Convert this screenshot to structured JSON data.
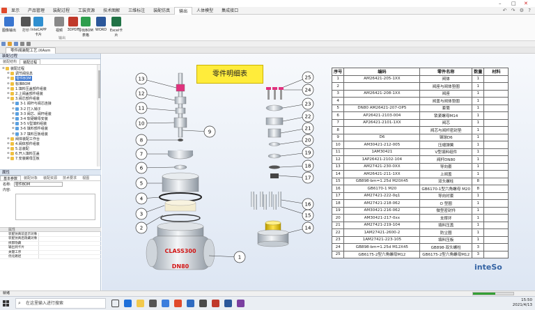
{
  "menubar": {
    "items": [
      "显示",
      "产品管理",
      "装配过程",
      "工装资源",
      "技术图解",
      "三维标注",
      "装配仿真",
      "输出",
      "人体模型",
      "集成接口"
    ],
    "active_index": 7
  },
  "ribbon": {
    "buttons": [
      "图像输出",
      "打印",
      "InteCAPP卡片",
      "视频",
      "3DPDF",
      "导出BOM表格",
      "WORD",
      "Excel卡片"
    ],
    "group_label": "输出"
  },
  "document_tab": "零件阀装配工艺.iXAsm",
  "left_panel": {
    "title": "装配过程",
    "tabs": [
      "装配结构",
      "装配过程"
    ],
    "active_tab": 1,
    "tree": [
      {
        "label": "装配过程",
        "level": 0
      },
      {
        "label": "调节阀信息",
        "level": 1
      },
      {
        "label": "零件BOM",
        "level": 1,
        "selected": true
      },
      {
        "label": "标准BOM",
        "level": 1
      },
      {
        "label": "1.填料压盖部件组装",
        "level": 1
      },
      {
        "label": "2.上阀盖部件组装",
        "level": 1
      },
      {
        "label": "3.阀芯部件组装",
        "level": 1
      },
      {
        "label": "3-1 阀杆与阀芯连接",
        "level": 2
      },
      {
        "label": "3-2 打入销子",
        "level": 2
      },
      {
        "label": "3-3 阀芯、阀杆组装",
        "level": 2
      },
      {
        "label": "3-4 软硬螺母安装",
        "level": 2
      },
      {
        "label": "3-5 V型填料组装",
        "level": 2
      },
      {
        "label": "3-6 填料部件组装",
        "level": 2
      },
      {
        "label": "3-7 填料压板组装",
        "level": 2
      },
      {
        "label": "阀体装配工作台",
        "level": 1
      },
      {
        "label": "4.阀体部件组装",
        "level": 1
      },
      {
        "label": "5.总装配",
        "level": 1
      },
      {
        "label": "6.开入填料压盖",
        "level": 1
      },
      {
        "label": "7.安装螺母压板",
        "level": 1
      }
    ]
  },
  "properties": {
    "title": "属性",
    "tabs": [
      "基本参数",
      "装配对象",
      "装配资源",
      "技术要求",
      "视图"
    ],
    "name_label": "名称:",
    "name_value": "零件BOM",
    "content_label": "内容:",
    "attr_section": "属性",
    "attrs": [
      "装配仿真前显示对象",
      "装配仿真后隐藏对象",
      "拆卸隐藏",
      "输出到卡片",
      "关键工序",
      "优化路径"
    ]
  },
  "canvas": {
    "title": "零件明细表",
    "brand": "inteSo",
    "flange_text_1": "CLASS300",
    "flange_text_2": "DN80",
    "callouts": [
      "1",
      "2",
      "3",
      "4",
      "5",
      "6",
      "7",
      "8",
      "9",
      "10",
      "11",
      "12",
      "13",
      "14",
      "15",
      "16",
      "17",
      "18",
      "19",
      "20",
      "21",
      "22",
      "23",
      "24",
      "25"
    ]
  },
  "parts_table": {
    "headers": [
      "序号",
      "编码",
      "零件名称",
      "数量",
      "材料"
    ],
    "rows": [
      [
        "1",
        "AM26421-205-1XX",
        "阀体",
        "1",
        ""
      ],
      [
        "2",
        "",
        "阀座与阀体垫圈",
        "1",
        ""
      ],
      [
        "3",
        "AM26421-208-1XX",
        "阀座",
        "1",
        ""
      ],
      [
        "4",
        "",
        "阀盖与阀体垫圈",
        "1",
        ""
      ],
      [
        "5",
        "DN80 AM26421-207-OP5",
        "套筒",
        "1",
        ""
      ],
      [
        "6",
        "AP26421-2103-004",
        "锁紧螺母M14",
        "1",
        ""
      ],
      [
        "7",
        "AP26421-2101-1XX",
        "阀芯",
        "1",
        ""
      ],
      [
        "8",
        "",
        "阀芯与阀杆密封垫",
        "1",
        ""
      ],
      [
        "9",
        "D6",
        "钢球D6",
        "1",
        ""
      ],
      [
        "10",
        "AM30421-212-005",
        "压缩弹簧",
        "1",
        ""
      ],
      [
        "11",
        "1AM30421",
        "V型填料组件",
        "1",
        ""
      ],
      [
        "12",
        "1AP26421-2102-104",
        "阀杆DN80",
        "1",
        ""
      ],
      [
        "13",
        "AM27421-230-0XX",
        "导向套",
        "1",
        ""
      ],
      [
        "14",
        "AM26421-211-1XX",
        "上阀盖",
        "1",
        ""
      ],
      [
        "15",
        "GB898-bm=1.25d M20X45",
        "双头螺柱",
        "8",
        ""
      ],
      [
        "16",
        "GB6170-1 M20",
        "GB6170-1型六角螺母 M20",
        "8",
        ""
      ],
      [
        "17",
        "AM27421-222-0q1",
        "导向衬套",
        "1",
        ""
      ],
      [
        "18",
        "AM27421-218-062",
        "O 型圈",
        "1",
        ""
      ],
      [
        "19",
        "AM30421-216-062",
        "微型密封件",
        "1",
        ""
      ],
      [
        "20",
        "AM30421-217-0xx",
        "支撑环",
        "1",
        ""
      ],
      [
        "21",
        "AM27421-219-104",
        "填料压盖",
        "1",
        ""
      ],
      [
        "22",
        "1AM27421-2600-2",
        "防尘圈",
        "1",
        ""
      ],
      [
        "23",
        "1AM27421-223-105",
        "填料压板",
        "1",
        ""
      ],
      [
        "24",
        "GB898-bm=1.25d M12X45",
        "GB898-双头螺柱",
        "3",
        ""
      ],
      [
        "25",
        "GB6175-2型六角螺母M12",
        "GB6175-2型六角螺母M12",
        "3",
        ""
      ]
    ]
  },
  "statusbar": {
    "text": "就绪",
    "progress": 0.55
  },
  "taskbar": {
    "search_placeholder": "在这里输入进行搜索",
    "time": "15:50",
    "date": "2021/4/13"
  },
  "colors": {
    "title_box": "#ffec3b",
    "accent_pink": "#e0327e",
    "selection": "#3a76d0",
    "brand": "#3463a3"
  }
}
